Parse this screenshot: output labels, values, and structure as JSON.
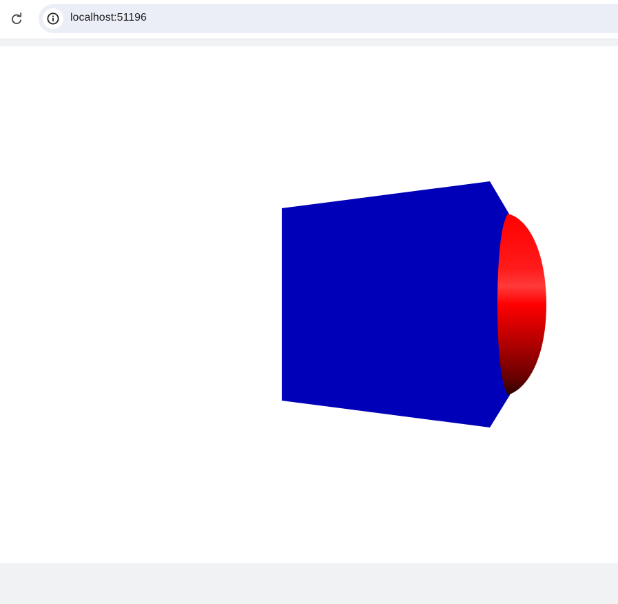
{
  "browser": {
    "url": "localhost:51196",
    "icons": {
      "reload": "reload-icon",
      "site_info": "info-icon"
    }
  },
  "scene": {
    "background": "#ffffff",
    "frustum_color": "#0000b8",
    "dome_color": "#ff0000",
    "dome_highlight": "#ff3a3a",
    "dome_shadow": "#2a0000"
  }
}
